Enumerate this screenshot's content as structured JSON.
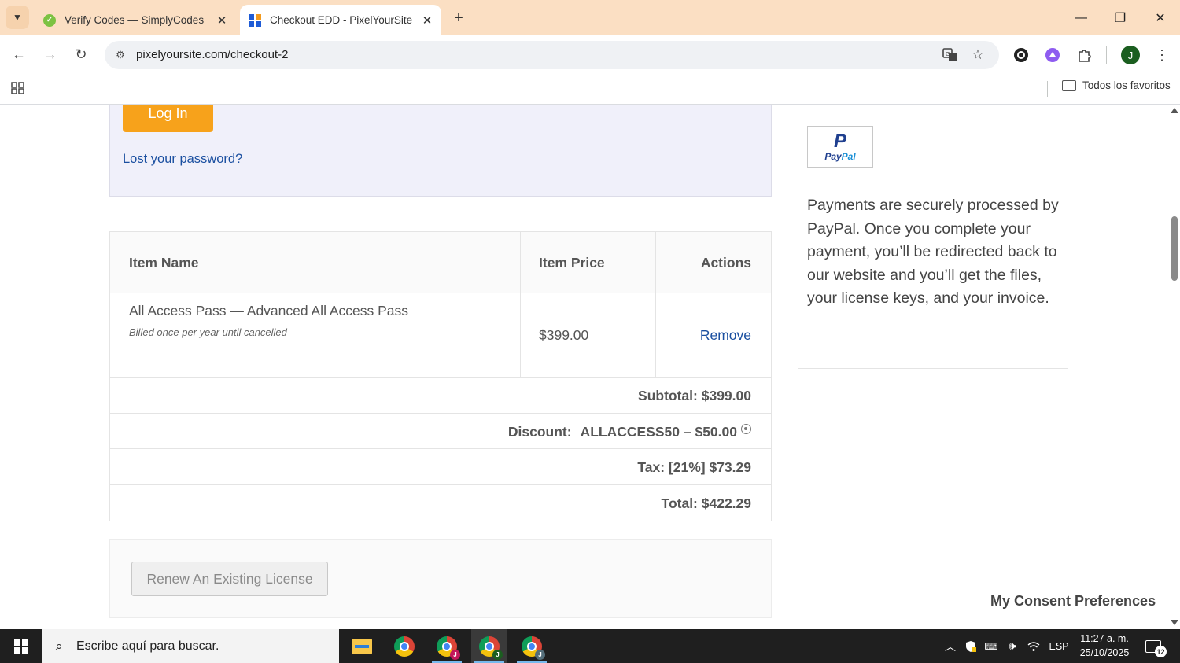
{
  "browser": {
    "tabs": [
      {
        "title": "Verify Codes — SimplyCodes",
        "active": false,
        "favicon": "simplycodes-icon"
      },
      {
        "title": "Checkout EDD - PixelYourSite",
        "active": true,
        "favicon": "pixelyoursite-icon"
      }
    ],
    "url": "pixelyoursite.com/checkout-2",
    "profile_initial": "J",
    "bookmarks_folder": "Todos los favoritos"
  },
  "login": {
    "button_label": "Log In",
    "lost_password": "Lost your password?"
  },
  "cart": {
    "columns": [
      "Item Name",
      "Item Price",
      "Actions"
    ],
    "items": [
      {
        "name": "All Access Pass — Advanced All Access Pass",
        "note": "Billed once per year until cancelled",
        "price": "$399.00",
        "action": "Remove"
      }
    ],
    "subtotal": "Subtotal: $399.00",
    "discount_label": "Discount:",
    "discount_value": "ALLACCESS50 – $50.00",
    "tax": "Tax: [21%] $73.29",
    "total": "Total: $422.29"
  },
  "renew": {
    "button_label": "Renew An Existing License"
  },
  "payment": {
    "logo_mark": "P",
    "logo_word_1": "Pay",
    "logo_word_2": "Pal",
    "text": "Payments are securely processed by PayPal. Once you complete your payment, you’ll be redirected back to our website and you’ll get the files, your license keys, and your invoice."
  },
  "consent": "My Consent Preferences",
  "taskbar": {
    "search_placeholder": "Escribe aquí para buscar.",
    "language": "ESP",
    "time": "11:27 a. m.",
    "date": "25/10/2025",
    "notifications": "12"
  },
  "colors": {
    "tabbar": "#fbdfc3",
    "login_button": "#f7a21b",
    "link": "#1a4fa0",
    "login_box": "#f0f0fa",
    "taskbar": "#1f1f1f"
  }
}
